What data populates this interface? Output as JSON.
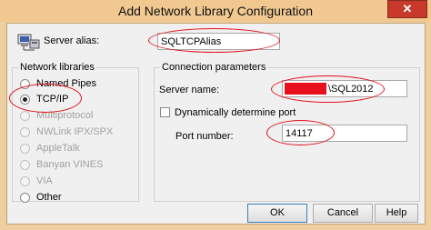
{
  "window": {
    "title": "Add Network Library Configuration",
    "close_glyph": "✕"
  },
  "alias": {
    "label": "Server alias:",
    "value": "SQLTCPAlias"
  },
  "libraries": {
    "title": "Network libraries",
    "options": [
      {
        "label": "Named Pipes",
        "enabled": true,
        "selected": false
      },
      {
        "label": "TCP/IP",
        "enabled": true,
        "selected": true
      },
      {
        "label": "Multiprotocol",
        "enabled": false,
        "selected": false
      },
      {
        "label": "NWLink IPX/SPX",
        "enabled": false,
        "selected": false
      },
      {
        "label": "AppleTalk",
        "enabled": false,
        "selected": false
      },
      {
        "label": "Banyan VINES",
        "enabled": false,
        "selected": false
      },
      {
        "label": "VIA",
        "enabled": false,
        "selected": false
      },
      {
        "label": "Other",
        "enabled": true,
        "selected": false
      }
    ]
  },
  "connection": {
    "title": "Connection parameters",
    "server_name_label": "Server name:",
    "server_name_value": "\\SQL2012",
    "dynamic_label": "Dynamically determine port",
    "dynamic_checked": false,
    "port_label": "Port number:",
    "port_value": "14117"
  },
  "buttons": {
    "ok": "OK",
    "cancel": "Cancel",
    "help": "Help"
  },
  "colors": {
    "annotation": "#e0121b",
    "titlebar": "#f0c890",
    "close_button": "#c7392b"
  }
}
